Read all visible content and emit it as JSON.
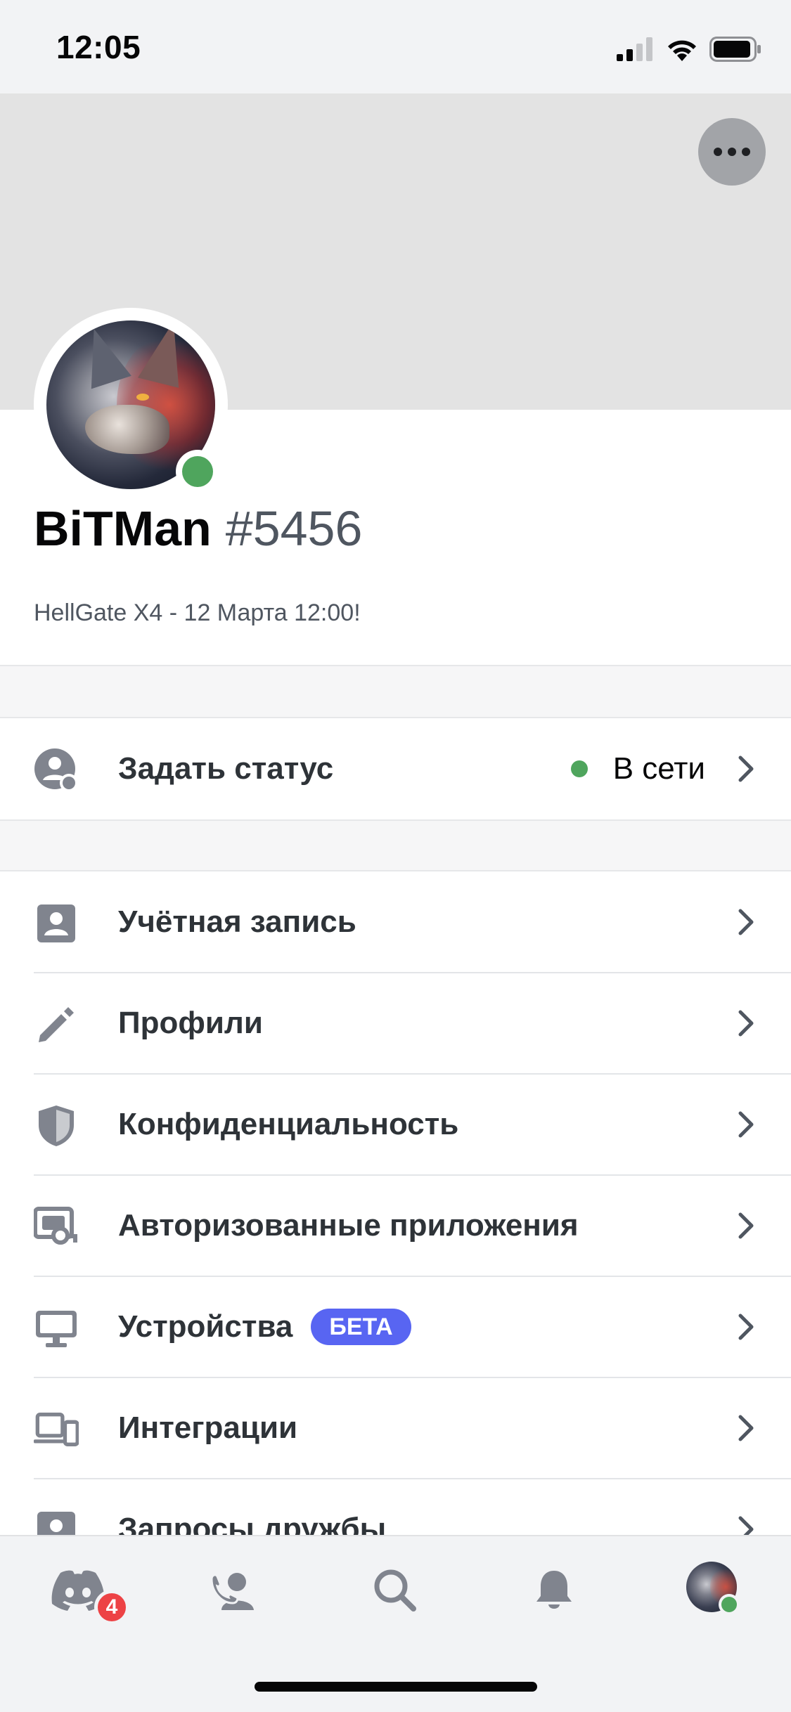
{
  "status_bar": {
    "time": "12:05"
  },
  "profile": {
    "username": "BiTMan",
    "discriminator": "#5456",
    "custom_status": "HellGate X4 - 12 Марта 12:00!",
    "presence_color": "#4fa55d"
  },
  "set_status": {
    "label": "Задать статус",
    "value": "В сети"
  },
  "settings_items": [
    {
      "label": "Учётная запись",
      "icon": "account-icon"
    },
    {
      "label": "Профили",
      "icon": "pencil-icon"
    },
    {
      "label": "Конфиденциальность",
      "icon": "shield-icon"
    },
    {
      "label": "Авторизованные приложения",
      "icon": "authorized-apps-icon"
    },
    {
      "label": "Устройства",
      "icon": "monitor-icon",
      "badge": "БЕТА"
    },
    {
      "label": "Интеграции",
      "icon": "devices-icon"
    },
    {
      "label": "Запросы дружбы",
      "icon": "friend-requests-icon"
    }
  ],
  "tab_bar": {
    "items": [
      "home",
      "friends",
      "search",
      "notifications",
      "profile"
    ],
    "home_badge": "4"
  },
  "colors": {
    "accent": "#5865f2",
    "online": "#4fa55d",
    "badge": "#ed4245"
  }
}
